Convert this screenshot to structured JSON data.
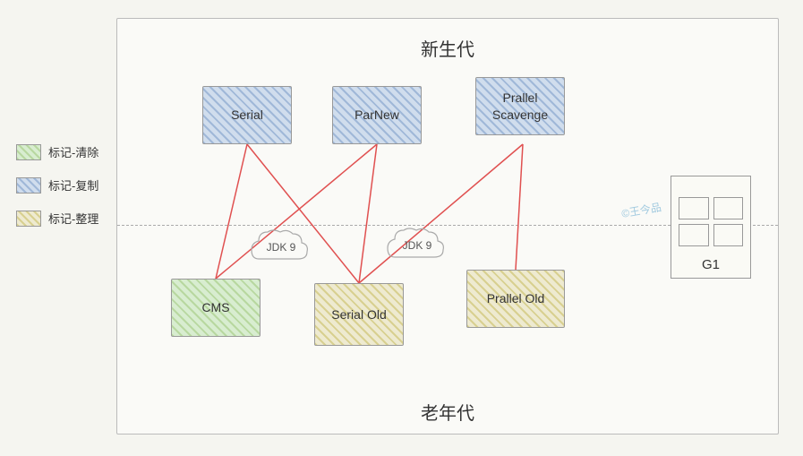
{
  "legend": {
    "items": [
      {
        "id": "legend-clear",
        "label": "标记-清除",
        "type": "green"
      },
      {
        "id": "legend-copy",
        "label": "标记-复制",
        "type": "blue"
      },
      {
        "id": "legend-compact",
        "label": "标记-整理",
        "type": "yellow"
      }
    ]
  },
  "diagram": {
    "region_top": "新生代",
    "region_bottom": "老年代",
    "boxes": [
      {
        "id": "serial",
        "label": "Serial",
        "type": "blue-hatch",
        "position": "top"
      },
      {
        "id": "parnew",
        "label": "ParNew",
        "type": "blue-hatch",
        "position": "top"
      },
      {
        "id": "prallel-scavenge",
        "label": "Prallel\nScavenge",
        "type": "blue-hatch",
        "position": "top"
      },
      {
        "id": "cms",
        "label": "CMS",
        "type": "green-hatch",
        "position": "bottom"
      },
      {
        "id": "serial-old",
        "label": "Serial Old",
        "type": "yellow-hatch",
        "position": "bottom"
      },
      {
        "id": "prallel-old",
        "label": "Prallel Old",
        "type": "yellow-hatch",
        "position": "bottom"
      },
      {
        "id": "g1",
        "label": "G1",
        "type": "special",
        "position": "both"
      }
    ],
    "jdk_labels": [
      {
        "id": "jdk9-left",
        "text": "JDK 9"
      },
      {
        "id": "jdk9-middle",
        "text": "JDK 9"
      }
    ],
    "watermark": "©王今品"
  }
}
